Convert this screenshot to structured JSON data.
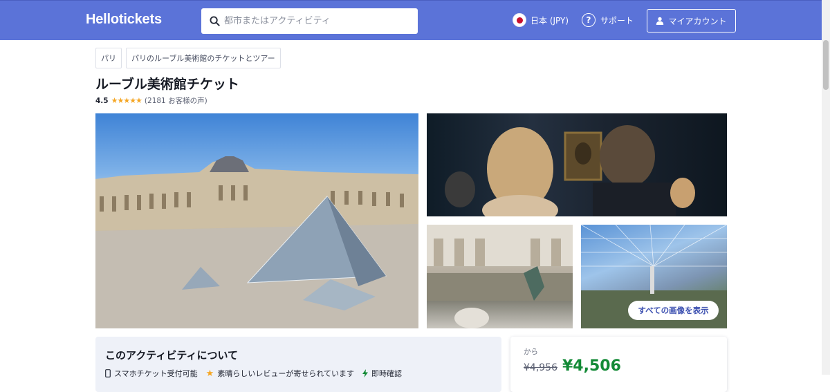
{
  "header": {
    "logo": "Hellotickets",
    "search_placeholder": "都市またはアクティビティ",
    "locale": "日本 (JPY)",
    "support": "サポート",
    "account": "マイアカウント",
    "bg_color": "#5b73d8"
  },
  "breadcrumb": [
    "パリ",
    "パリのルーブル美術館のチケットとツアー"
  ],
  "product": {
    "title": "ルーブル美術館チケット",
    "rating": "4.5",
    "rating_value": 4.5,
    "stars": "★★★★★",
    "review_count": "(2181 お客様の声)"
  },
  "gallery": {
    "show_all": "すべての画像を表示"
  },
  "about": {
    "title": "このアクティビティについて",
    "features": [
      {
        "icon": "phone-icon",
        "label": "スマホチケット受付可能"
      },
      {
        "icon": "star-icon",
        "label": "素晴らしいレビューが寄せられています"
      },
      {
        "icon": "lightning-icon",
        "label": "即時確認"
      }
    ]
  },
  "price": {
    "from": "から",
    "old": "¥4,956",
    "new": "¥4,506",
    "accent": "#138a36"
  }
}
